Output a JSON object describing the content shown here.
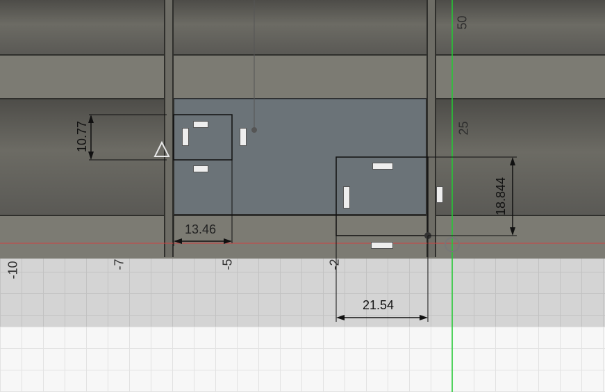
{
  "canvas": {
    "accent_green": "#22cc33",
    "axis_red": "#d04040",
    "profile_fill": "#5a6e82"
  },
  "dimensions": [
    {
      "id": "dim-height-left",
      "value": "10.77"
    },
    {
      "id": "dim-width-left",
      "value": "13.46"
    },
    {
      "id": "dim-width-bottom",
      "value": "21.54"
    },
    {
      "id": "dim-height-right",
      "value": "18.844"
    }
  ],
  "ruler_vertical": [
    "50",
    "25"
  ],
  "ruler_horizontal": [
    "-10",
    "-7",
    "-5",
    "-2"
  ],
  "icons": {
    "warning": "triangle-warning-icon",
    "constraint": "horizontal-constraint-icon",
    "origin": "origin-point-icon"
  }
}
